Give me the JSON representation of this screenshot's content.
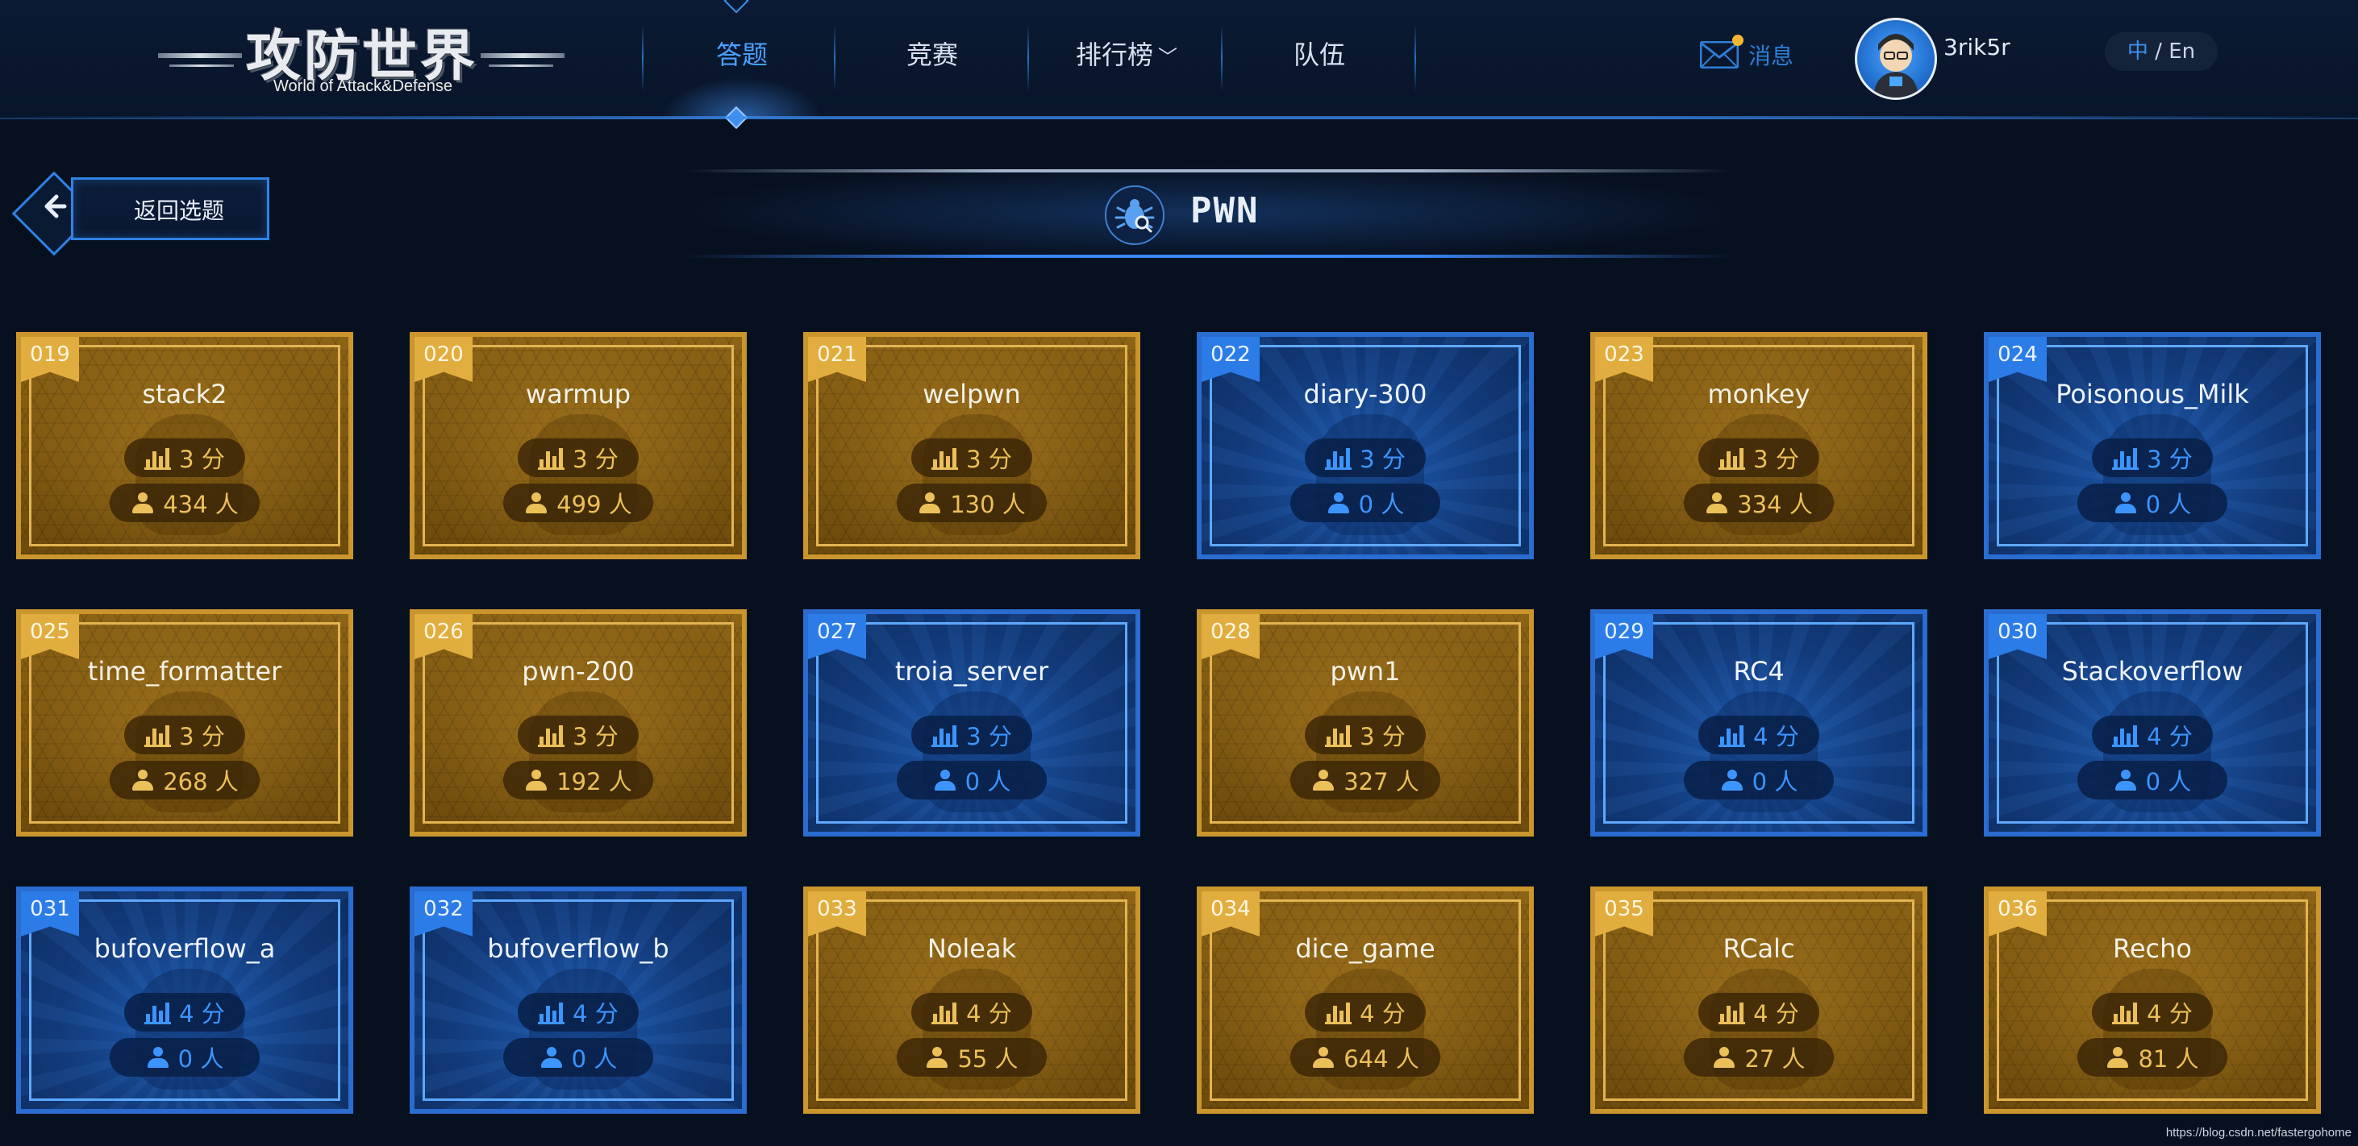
{
  "header": {
    "logo_title": "攻防世界",
    "logo_subtitle": "World of Attack&Defense",
    "nav": [
      {
        "label": "答题",
        "active": true
      },
      {
        "label": "竞赛",
        "active": false
      },
      {
        "label": "排行榜",
        "active": false,
        "has_dropdown": true
      },
      {
        "label": "队伍",
        "active": false
      }
    ],
    "messages_label": "消息",
    "has_unread_message": true,
    "username": "3rik5r",
    "lang_current": "中",
    "lang_sep": " / ",
    "lang_other": "En"
  },
  "back_button_label": "返回选题",
  "category_title": "PWN",
  "cards": [
    {
      "id": "019",
      "name": "stack2",
      "score": "3 分",
      "solvers": "434 人",
      "theme": "gold"
    },
    {
      "id": "020",
      "name": "warmup",
      "score": "3 分",
      "solvers": "499 人",
      "theme": "gold"
    },
    {
      "id": "021",
      "name": "welpwn",
      "score": "3 分",
      "solvers": "130 人",
      "theme": "gold"
    },
    {
      "id": "022",
      "name": "diary-300",
      "score": "3 分",
      "solvers": "0 人",
      "theme": "blue"
    },
    {
      "id": "023",
      "name": "monkey",
      "score": "3 分",
      "solvers": "334 人",
      "theme": "gold"
    },
    {
      "id": "024",
      "name": "Poisonous_Milk",
      "score": "3 分",
      "solvers": "0 人",
      "theme": "blue"
    },
    {
      "id": "025",
      "name": "time_formatter",
      "score": "3 分",
      "solvers": "268 人",
      "theme": "gold"
    },
    {
      "id": "026",
      "name": "pwn-200",
      "score": "3 分",
      "solvers": "192 人",
      "theme": "gold"
    },
    {
      "id": "027",
      "name": "troia_server",
      "score": "3 分",
      "solvers": "0 人",
      "theme": "blue"
    },
    {
      "id": "028",
      "name": "pwn1",
      "score": "3 分",
      "solvers": "327 人",
      "theme": "gold"
    },
    {
      "id": "029",
      "name": "RC4",
      "score": "4 分",
      "solvers": "0 人",
      "theme": "blue"
    },
    {
      "id": "030",
      "name": "Stackoverflow",
      "score": "4 分",
      "solvers": "0 人",
      "theme": "blue"
    },
    {
      "id": "031",
      "name": "bufoverflow_a",
      "score": "4 分",
      "solvers": "0 人",
      "theme": "blue"
    },
    {
      "id": "032",
      "name": "bufoverflow_b",
      "score": "4 分",
      "solvers": "0 人",
      "theme": "blue"
    },
    {
      "id": "033",
      "name": "Noleak",
      "score": "4 分",
      "solvers": "55 人",
      "theme": "gold"
    },
    {
      "id": "034",
      "name": "dice_game",
      "score": "4 分",
      "solvers": "644 人",
      "theme": "gold"
    },
    {
      "id": "035",
      "name": "RCalc",
      "score": "4 分",
      "solvers": "27 人",
      "theme": "gold"
    },
    {
      "id": "036",
      "name": "Recho",
      "score": "4 分",
      "solvers": "81 人",
      "theme": "gold"
    }
  ],
  "watermark_url": "https://blog.csdn.net/fastergohome",
  "colors": {
    "background": "#07101f",
    "accent_blue": "#3c95ff",
    "gold": "#c9952c",
    "card_blue": "#2a6cd0",
    "unread_dot": "#f2b632"
  }
}
